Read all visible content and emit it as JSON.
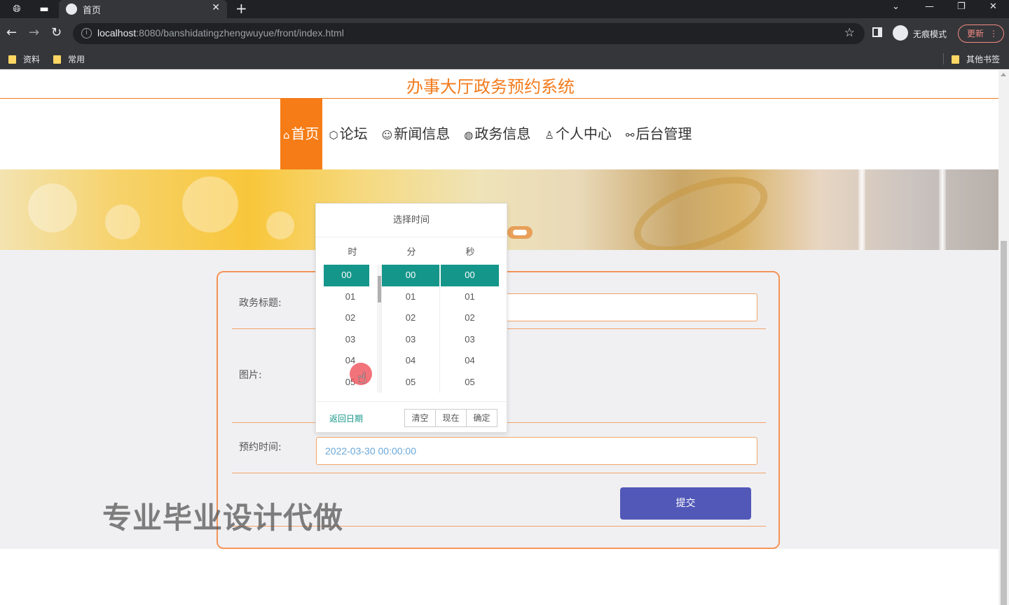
{
  "browser": {
    "tab_title": "首页",
    "url_host": "localhost",
    "url_rest": ":8080/banshidatingzhengwuyue/front/index.html",
    "incognito_label": "无痕模式",
    "update_label": "更新",
    "bookmarks": [
      "资料",
      "常用"
    ],
    "other_bookmarks": "其他书签"
  },
  "site": {
    "title": "办事大厅政务预约系统",
    "nav": [
      {
        "icon": "⌂",
        "label": "首页",
        "active": true
      },
      {
        "icon": "⬡",
        "label": "论坛"
      },
      {
        "icon": "☺",
        "label": "新闻信息"
      },
      {
        "icon": "◍",
        "label": "政务信息"
      },
      {
        "icon": "♙",
        "label": "个人中心"
      },
      {
        "icon": "⚯",
        "label": "后台管理"
      }
    ]
  },
  "form": {
    "title_label": "政务标题:",
    "image_label": "图片:",
    "time_label": "预约时间:",
    "time_value": "2022-03-30 00:00:00",
    "submit_label": "提交"
  },
  "picker": {
    "header": "选择时间",
    "col_hour": "时",
    "col_min": "分",
    "col_sec": "秒",
    "values": [
      "00",
      "01",
      "02",
      "03",
      "04",
      "05"
    ],
    "back_date": "返回日期",
    "clear": "清空",
    "now": "现在",
    "confirm": "确定"
  },
  "watermark": "专业毕业设计代做"
}
